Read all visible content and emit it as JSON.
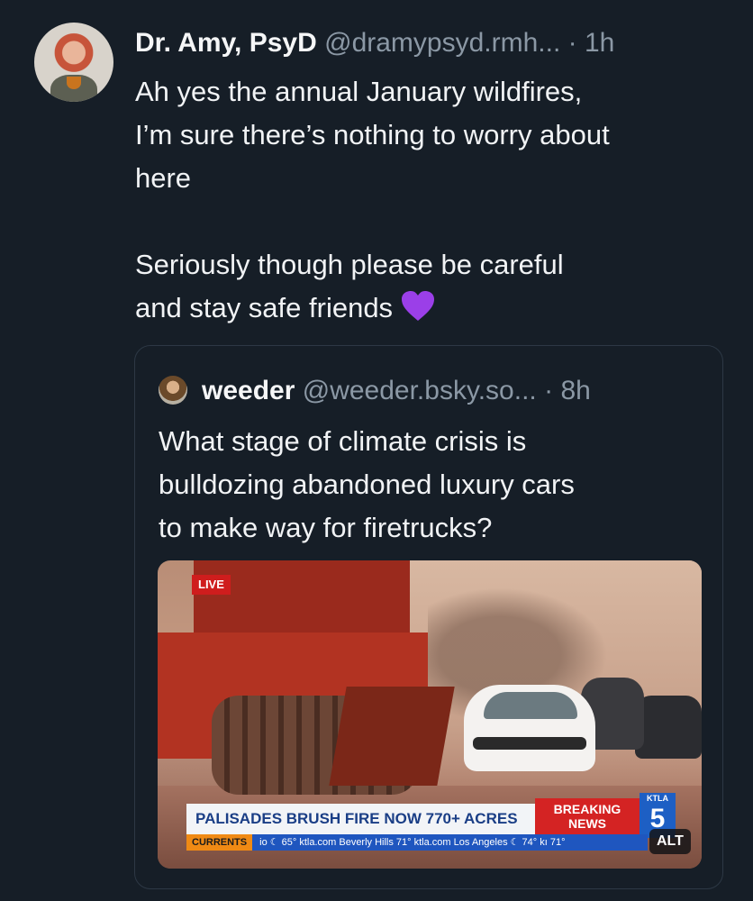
{
  "post": {
    "display_name": "Dr. Amy, PsyD",
    "handle": "@dramypsyd.rmh...",
    "separator": "·",
    "time": "1h",
    "text_lines": [
      "Ah yes the annual January wildfires,",
      "I’m sure there’s nothing to worry about",
      "here",
      "Seriously though please be careful",
      "and stay safe friends"
    ],
    "emoji_icon": "purple-heart-icon"
  },
  "quote": {
    "display_name": "weeder",
    "handle": "@weeder.bsky.so...",
    "separator": "·",
    "time": "8h",
    "text_lines": [
      "What stage of climate crisis is",
      "bulldozing abandoned luxury cars",
      "to make way for firetrucks?"
    ],
    "image": {
      "live_label": "LIVE",
      "banner_headline": "PALISADES BRUSH FIRE NOW 770+ ACRES",
      "breaking_line1": "BREAKING",
      "breaking_line2": "NEWS",
      "station_small": "KTLA",
      "station_number": "5",
      "ticker_label": "CURRENTS",
      "ticker_text": "io ☾ 65° ktla.com Beverly Hills 71° ktla.com Los Angeles ☾ 74° kı 71°",
      "alt_label": "ALT"
    }
  },
  "colors": {
    "background": "#161e27",
    "secondary_text": "#8b98a5",
    "quote_border": "#2d3845",
    "heart": "#9b3fe8"
  }
}
